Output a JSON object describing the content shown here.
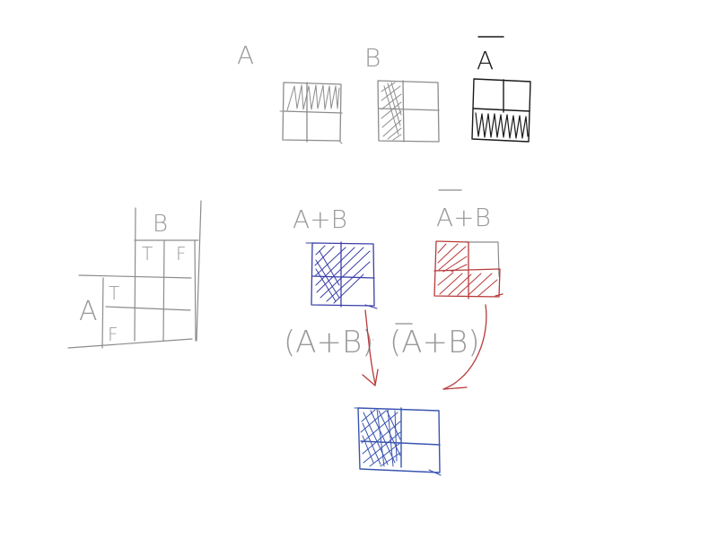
{
  "top_row": {
    "label_a": "A",
    "label_b": "B",
    "label_not_a": "A"
  },
  "truth_table": {
    "row_header": "A",
    "col_header": "B",
    "col_true": "T",
    "col_false": "F",
    "row_true": "T",
    "row_false": "F"
  },
  "middle_row": {
    "label_a_or_b": "A+B",
    "label_not_a_or_b": "A+B"
  },
  "expression": {
    "left": "(A+B)",
    "operator": "·",
    "right": "(A+B)"
  },
  "colors": {
    "pencil_gray": "#8c8c8c",
    "ink_dark": "#1a1a1a",
    "ink_blue": "#3a3fa8",
    "ink_red": "#b83a3a"
  }
}
